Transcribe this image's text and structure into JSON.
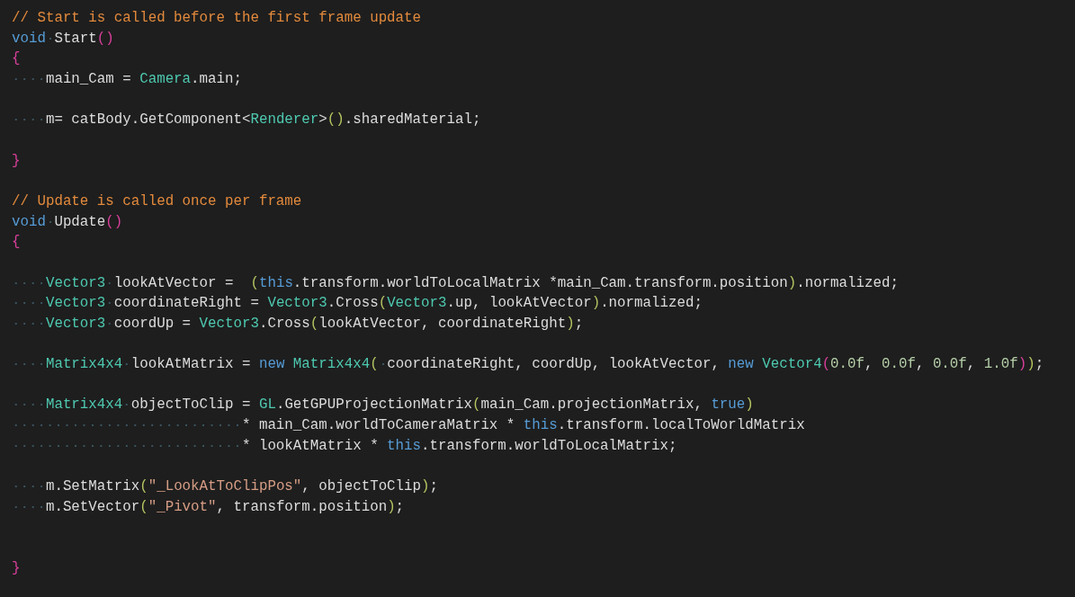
{
  "editor": {
    "lines": [
      {
        "kind": "code",
        "tokens": [
          {
            "kind": "comment",
            "text": "// Start is called before the first frame update"
          }
        ]
      },
      {
        "kind": "code",
        "tokens": [
          {
            "kind": "keyword",
            "text": "void"
          },
          {
            "kind": "plain",
            "text": " Start"
          },
          {
            "kind": "bracket1",
            "text": "()"
          }
        ]
      },
      {
        "kind": "code",
        "tokens": [
          {
            "kind": "bracket1",
            "text": "{"
          }
        ]
      },
      {
        "kind": "code",
        "tokens": [
          {
            "kind": "plain",
            "text": "    main_Cam = "
          },
          {
            "kind": "type",
            "text": "Camera"
          },
          {
            "kind": "plain",
            "text": ".main;"
          }
        ]
      },
      {
        "kind": "blank"
      },
      {
        "kind": "code",
        "tokens": [
          {
            "kind": "plain",
            "text": "    m= catBody.GetComponent<"
          },
          {
            "kind": "type",
            "text": "Renderer"
          },
          {
            "kind": "plain",
            "text": ">"
          },
          {
            "kind": "bracket2",
            "text": "()"
          },
          {
            "kind": "plain",
            "text": ".sharedMaterial;"
          }
        ]
      },
      {
        "kind": "blank"
      },
      {
        "kind": "code",
        "tokens": [
          {
            "kind": "bracket1",
            "text": "}"
          }
        ]
      },
      {
        "kind": "blank"
      },
      {
        "kind": "code",
        "tokens": [
          {
            "kind": "comment",
            "text": "// Update is called once per frame"
          }
        ]
      },
      {
        "kind": "code",
        "tokens": [
          {
            "kind": "keyword",
            "text": "void"
          },
          {
            "kind": "plain",
            "text": " Update"
          },
          {
            "kind": "bracket1",
            "text": "()"
          }
        ]
      },
      {
        "kind": "code",
        "tokens": [
          {
            "kind": "bracket1",
            "text": "{"
          }
        ]
      },
      {
        "kind": "blank"
      },
      {
        "kind": "code",
        "tokens": [
          {
            "kind": "type",
            "text": "    Vector3"
          },
          {
            "kind": "plain",
            "text": " lookAtVector =  "
          },
          {
            "kind": "bracket2",
            "text": "("
          },
          {
            "kind": "keyword",
            "text": "this"
          },
          {
            "kind": "plain",
            "text": ".transform.worldToLocalMatrix *main_Cam.transform.position"
          },
          {
            "kind": "bracket2",
            "text": ")"
          },
          {
            "kind": "plain",
            "text": ".normalized;"
          }
        ]
      },
      {
        "kind": "code",
        "tokens": [
          {
            "kind": "type",
            "text": "    Vector3"
          },
          {
            "kind": "plain",
            "text": " coordinateRight = "
          },
          {
            "kind": "type",
            "text": "Vector3"
          },
          {
            "kind": "plain",
            "text": ".Cross"
          },
          {
            "kind": "bracket2",
            "text": "("
          },
          {
            "kind": "type",
            "text": "Vector3"
          },
          {
            "kind": "plain",
            "text": ".up, lookAtVector"
          },
          {
            "kind": "bracket2",
            "text": ")"
          },
          {
            "kind": "plain",
            "text": ".normalized;"
          }
        ]
      },
      {
        "kind": "code",
        "tokens": [
          {
            "kind": "type",
            "text": "    Vector3"
          },
          {
            "kind": "plain",
            "text": " coordUp = "
          },
          {
            "kind": "type",
            "text": "Vector3"
          },
          {
            "kind": "plain",
            "text": ".Cross"
          },
          {
            "kind": "bracket2",
            "text": "("
          },
          {
            "kind": "plain",
            "text": "lookAtVector, coordinateRight"
          },
          {
            "kind": "bracket2",
            "text": ")"
          },
          {
            "kind": "plain",
            "text": ";"
          }
        ]
      },
      {
        "kind": "blank"
      },
      {
        "kind": "code",
        "tokens": [
          {
            "kind": "type",
            "text": "    Matrix4x4"
          },
          {
            "kind": "plain",
            "text": " lookAtMatrix = "
          },
          {
            "kind": "keyword",
            "text": "new "
          },
          {
            "kind": "type",
            "text": "Matrix4x4"
          },
          {
            "kind": "bracket2",
            "text": "("
          },
          {
            "kind": "plain",
            "text": " coordinateRight, coordUp, lookAtVector, "
          },
          {
            "kind": "keyword",
            "text": "new "
          },
          {
            "kind": "type",
            "text": "Vector4"
          },
          {
            "kind": "bracket1",
            "text": "("
          },
          {
            "kind": "number",
            "text": "0.0f"
          },
          {
            "kind": "plain",
            "text": ", "
          },
          {
            "kind": "number",
            "text": "0.0f"
          },
          {
            "kind": "plain",
            "text": ", "
          },
          {
            "kind": "number",
            "text": "0.0f"
          },
          {
            "kind": "plain",
            "text": ", "
          },
          {
            "kind": "number",
            "text": "1.0f"
          },
          {
            "kind": "bracket1",
            "text": ")"
          },
          {
            "kind": "bracket2",
            "text": ")"
          },
          {
            "kind": "plain",
            "text": ";"
          }
        ]
      },
      {
        "kind": "blank"
      },
      {
        "kind": "code",
        "tokens": [
          {
            "kind": "type",
            "text": "    Matrix4x4"
          },
          {
            "kind": "plain",
            "text": " objectToClip = "
          },
          {
            "kind": "type",
            "text": "GL"
          },
          {
            "kind": "plain",
            "text": ".GetGPUProjectionMatrix"
          },
          {
            "kind": "bracket2",
            "text": "("
          },
          {
            "kind": "plain",
            "text": "main_Cam.projectionMatrix, "
          },
          {
            "kind": "keyword",
            "text": "true"
          },
          {
            "kind": "bracket2",
            "text": ")"
          }
        ]
      },
      {
        "kind": "code",
        "tokens": [
          {
            "kind": "plain",
            "text": "                           * main_Cam.worldToCameraMatrix * "
          },
          {
            "kind": "keyword",
            "text": "this"
          },
          {
            "kind": "plain",
            "text": ".transform.localToWorldMatrix"
          }
        ]
      },
      {
        "kind": "code",
        "tokens": [
          {
            "kind": "plain",
            "text": "                           * lookAtMatrix * "
          },
          {
            "kind": "keyword",
            "text": "this"
          },
          {
            "kind": "plain",
            "text": ".transform.worldToLocalMatrix;"
          }
        ]
      },
      {
        "kind": "blank"
      },
      {
        "kind": "code",
        "tokens": [
          {
            "kind": "plain",
            "text": "    m.SetMatrix"
          },
          {
            "kind": "bracket2",
            "text": "("
          },
          {
            "kind": "string",
            "text": "\"_LookAtToClipPos\""
          },
          {
            "kind": "plain",
            "text": ", objectToClip"
          },
          {
            "kind": "bracket2",
            "text": ")"
          },
          {
            "kind": "plain",
            "text": ";"
          }
        ]
      },
      {
        "kind": "code",
        "tokens": [
          {
            "kind": "plain",
            "text": "    m.SetVector"
          },
          {
            "kind": "bracket2",
            "text": "("
          },
          {
            "kind": "string",
            "text": "\"_Pivot\""
          },
          {
            "kind": "plain",
            "text": ", transform.position"
          },
          {
            "kind": "bracket2",
            "text": ")"
          },
          {
            "kind": "plain",
            "text": ";"
          }
        ]
      },
      {
        "kind": "blank"
      },
      {
        "kind": "blank"
      },
      {
        "kind": "code",
        "tokens": [
          {
            "kind": "bracket1",
            "text": "}"
          }
        ]
      }
    ]
  }
}
